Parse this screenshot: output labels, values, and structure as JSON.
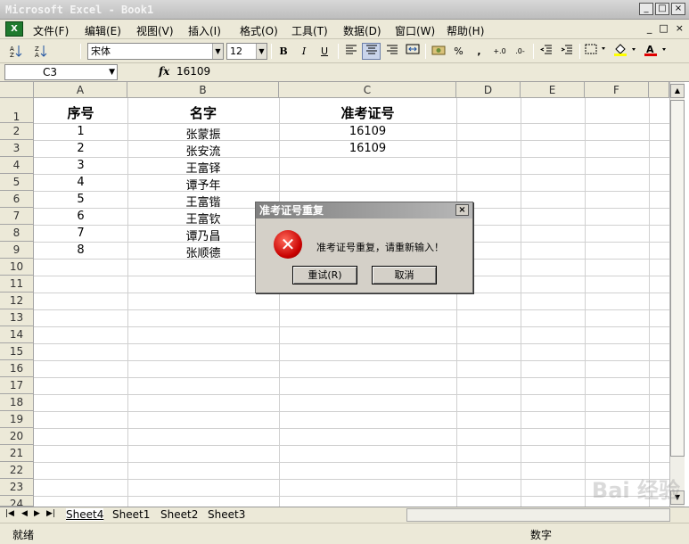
{
  "window": {
    "title": "Microsoft Excel - Book1",
    "controls": [
      "_",
      "□",
      "×"
    ]
  },
  "menubar": {
    "items": [
      "文件(F)",
      "编辑(E)",
      "视图(V)",
      "插入(I)",
      "格式(O)",
      "工具(T)",
      "数据(D)",
      "窗口(W)",
      "帮助(H)"
    ],
    "mdi_controls": [
      "_",
      "□",
      "×"
    ]
  },
  "toolbar": {
    "font_name": "宋体",
    "font_size": "12",
    "bold": "B",
    "italic": "I",
    "underline": "U",
    "percent": "%",
    "comma": ",",
    "inc_decimal": "+.0",
    "dec_decimal": ".0-"
  },
  "formula_bar": {
    "name_box": "C3",
    "fx": "fx",
    "value": "16109"
  },
  "columns": [
    "A",
    "B",
    "C",
    "D",
    "E",
    "F"
  ],
  "rows": [
    "1",
    "2",
    "3",
    "4",
    "5",
    "6",
    "7",
    "8",
    "9",
    "10",
    "11",
    "12",
    "13",
    "14",
    "15",
    "16",
    "17",
    "18",
    "19",
    "20",
    "21",
    "22",
    "23",
    "24"
  ],
  "header_row": {
    "A": "序号",
    "B": "名字",
    "C": "准考证号"
  },
  "data_rows": [
    {
      "A": "1",
      "B": "张蒙振",
      "C": "16109"
    },
    {
      "A": "2",
      "B": "张安流",
      "C": "16109"
    },
    {
      "A": "3",
      "B": "王富铎",
      "C": ""
    },
    {
      "A": "4",
      "B": "谭予年",
      "C": ""
    },
    {
      "A": "5",
      "B": "王富锴",
      "C": ""
    },
    {
      "A": "6",
      "B": "王富钦",
      "C": ""
    },
    {
      "A": "7",
      "B": "谭乃昌",
      "C": ""
    },
    {
      "A": "8",
      "B": "张顺德",
      "C": ""
    }
  ],
  "sheet_tabs": [
    "Sheet4",
    "Sheet1",
    "Sheet2",
    "Sheet3"
  ],
  "active_sheet": "Sheet4",
  "status": {
    "left": "就绪",
    "right": "数字"
  },
  "dialog": {
    "title": "准考证号重复",
    "close": "×",
    "message": "准考证号重复，请重新输入！",
    "retry_label": "重试(R)",
    "cancel_label": "取消",
    "icon": "error-icon"
  },
  "watermark": "Bai 经验"
}
